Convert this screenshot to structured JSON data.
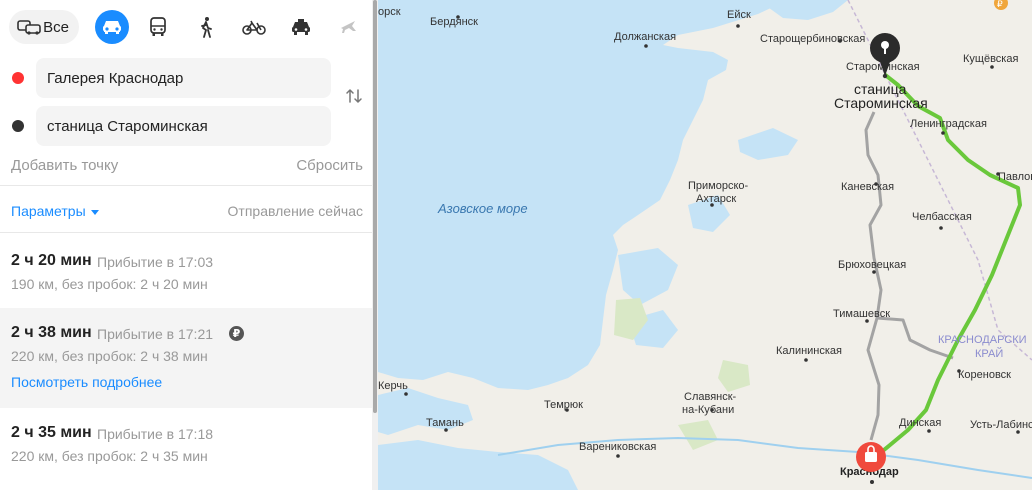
{
  "modes": {
    "all_label": "Все",
    "items": [
      {
        "name": "car",
        "icon": "car-icon"
      },
      {
        "name": "bus",
        "icon": "bus-icon"
      },
      {
        "name": "walk",
        "icon": "walk-icon"
      },
      {
        "name": "bike",
        "icon": "bike-icon"
      },
      {
        "name": "taxi",
        "icon": "taxi-icon"
      },
      {
        "name": "plane",
        "icon": "plane-icon"
      }
    ],
    "active": "car"
  },
  "route_form": {
    "from": "Галерея Краснодар",
    "to": "станица Староминская",
    "add_point": "Добавить точку",
    "reset": "Сбросить"
  },
  "options": {
    "params_label": "Параметры",
    "departure": "Отправление сейчас"
  },
  "routes": [
    {
      "duration": "2 ч 20 мин",
      "arrival": "Прибытие в 17:03",
      "details": "190 км, без пробок: 2 ч 20 мин",
      "paid": false,
      "more": ""
    },
    {
      "duration": "2 ч 38 мин",
      "arrival": "Прибытие в 17:21",
      "details": "220 км, без пробок: 2 ч 38 мин",
      "paid": true,
      "paid_badge": "₽",
      "more": "Посмотреть подробнее"
    },
    {
      "duration": "2 ч 35 мин",
      "arrival": "Прибытие в 17:18",
      "details": "220 км, без пробок: 2 ч 35 мин",
      "paid": false,
      "more": ""
    }
  ],
  "map": {
    "sea_label": "Азовское море",
    "region_label_1": "КРАСНОДАРСКИ",
    "region_label_2": "КРАЙ",
    "destination_label_1": "станица",
    "destination_label_2": "Староминская",
    "origin_label": "Краснодар",
    "cities": {
      "orsk": "орск",
      "berdyansk": "Бердянск",
      "yeysk": "Ейск",
      "dolzhanskaya": "Должанская",
      "staroshcherbinovskaya": "Старощербиновская",
      "starominskaya": "Староминская",
      "kushchevskaya": "Кущёвская",
      "leningradskaya": "Ленинградская",
      "pavlovskaya": "Павлов",
      "primorsko_akhtarsk_1": "Приморско-",
      "primorsko_akhtarsk_2": "Ахтарск",
      "kanevskaya": "Каневская",
      "chelbasskaya": "Челбасская",
      "bryukhovetskaya": "Брюховецкая",
      "timashevsk": "Тимашевск",
      "kalininskaya": "Калининская",
      "korenovsk": "Кореновск",
      "kerch": "Керчь",
      "temryuk": "Темрюк",
      "slavyansk_1": "Славянск-",
      "slavyansk_2": "на-Кубани",
      "taman": "Тамань",
      "varenikovskaya": "Варениковская",
      "dinskaya": "Динская",
      "ust_labinsk": "Усть-Лабинс"
    },
    "colors": {
      "water": "#c5e3f6",
      "land": "#f1efe9",
      "route_active": "#6ac83b",
      "route_alt": "#a3a3a3",
      "origin_marker": "#f04a3d",
      "destination_marker": "#2b2b2b"
    }
  }
}
